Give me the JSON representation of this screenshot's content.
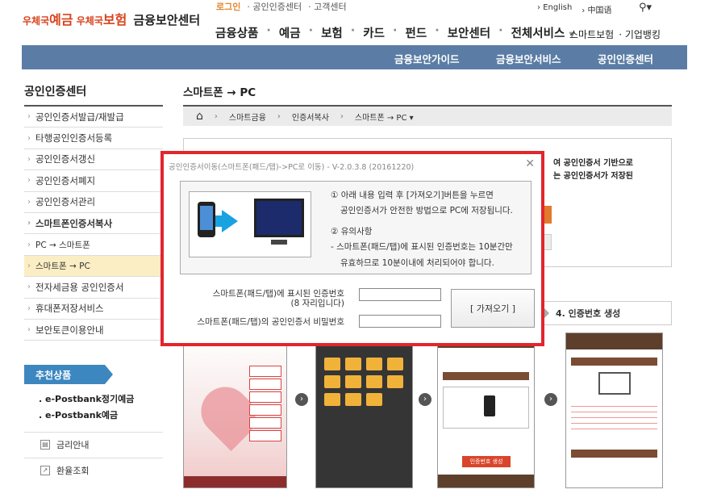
{
  "header": {
    "top_links": [
      "로그인",
      "공인인증센터",
      "고객센터"
    ],
    "languages": [
      "English",
      "中国语"
    ],
    "logo_brand1": "우체국",
    "logo_brand1_big": "예금",
    "logo_brand2": "우체국",
    "logo_brand2_big": "보험",
    "site_name": "금융보안센터",
    "gnb": [
      "금융상품",
      "예금",
      "보험",
      "카드",
      "펀드",
      "보안센터",
      "전체서비스"
    ],
    "gnb_extra": [
      "스마트보험",
      "기업뱅킹"
    ]
  },
  "subbar": [
    "금융보안가이드",
    "금융보안서비스",
    "공인인증센터"
  ],
  "sidebar": {
    "title": "공인인증센터",
    "items": [
      {
        "label": "공인인증서발급/재발급"
      },
      {
        "label": "타행공인인증서등록"
      },
      {
        "label": "공인인증서갱신"
      },
      {
        "label": "공인인증서폐지"
      },
      {
        "label": "공인인증서관리"
      },
      {
        "label": "스마트폰인증서복사"
      },
      {
        "label": "PC → 스마트폰"
      },
      {
        "label": "스마트폰 → PC"
      },
      {
        "label": "전자세금용 공인인증서"
      },
      {
        "label": "휴대폰저장서비스"
      },
      {
        "label": "보안토큰이용안내"
      }
    ],
    "promo_title": "추천상품",
    "products": [
      "e-Postbank정기예금",
      "e-Postbank예금"
    ],
    "utils": [
      "금리안내",
      "환율조회"
    ]
  },
  "main": {
    "title": "스마트폰 → PC",
    "breadcrumb": [
      "스마트금융",
      "인증서복사",
      "스마트폰 → PC"
    ],
    "info_line1": "여 공인인증서 기반으로",
    "info_line2": "는 공인인증서가 저장된",
    "step4": "4. 인증번호 생성",
    "phone_button": "인증번호 생성"
  },
  "modal": {
    "title": "공인인증서이동(스마트폰(패드/탭)->PC로 이동) - V-2.0.3.8 (20161220)",
    "instr_line1": "① 아래 내용 입력 후 [가져오기]버튼을 누르면",
    "instr_line2": "공인인증서가 안전한 방법으로 PC에 저장됩니다.",
    "notice_title": "② 유의사항",
    "notice_line1": "-  스마트폰(패드/탭)에 표시된 인증번호는 10분간만",
    "notice_line2": "유효하므로 10분이내에 처리되어야 합니다.",
    "code_label1": "스마트폰(패드/탭)에 표시된 인증번호",
    "code_label2": "(8 자리입니다)",
    "pw_label": "스마트폰(패드/탭)의 공인인증서 비밀번호",
    "code_value": "",
    "pw_value": "",
    "get_button": "[  가져오기  ]"
  }
}
